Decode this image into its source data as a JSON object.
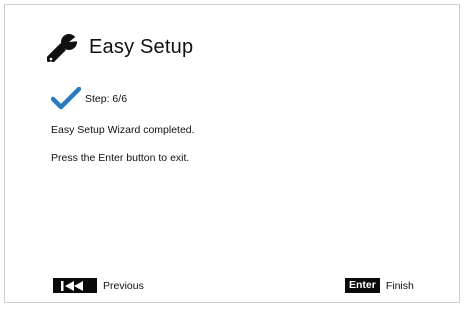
{
  "header": {
    "icon": "wrench-icon",
    "title": "Easy Setup"
  },
  "step": {
    "icon": "checkmark-icon",
    "label": "Step: 6/6",
    "check_color": "#2a7bbf"
  },
  "messages": {
    "completed": "Easy Setup Wizard completed.",
    "instruction": "Press the Enter button to exit."
  },
  "footer": {
    "previous": {
      "key_icon": "skip-back-icon",
      "label": "Previous"
    },
    "finish": {
      "key_label": "Enter",
      "label": "Finish"
    }
  }
}
